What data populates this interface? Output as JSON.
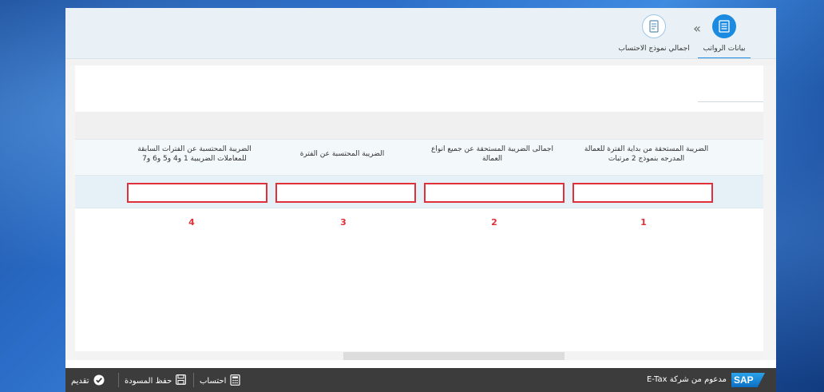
{
  "header": {
    "steps": [
      {
        "label": "بيانات الرواتب",
        "active": true,
        "icon": "list-icon"
      },
      {
        "label": "اجمالي نموذج الاحتساب",
        "active": false,
        "icon": "document-icon"
      }
    ],
    "separator": "«"
  },
  "table": {
    "columns": [
      {
        "number": "1",
        "header": "الضريبة المستحقة من بداية الفترة للعمالة المدرجه بنموذج 2 مرتبات",
        "value": ""
      },
      {
        "number": "2",
        "header": "اجمالى الضريبة المستحقة عن جميع انواع العمالة",
        "value": ""
      },
      {
        "number": "3",
        "header": "الضريبة المحتسبة عن الفترة",
        "value": ""
      },
      {
        "number": "4",
        "header": "الضريبة المحتسبة عن الفترات السابقة للمعاملات الضريبية 1 و4 و5 و6 و7",
        "value": ""
      }
    ]
  },
  "footer": {
    "powered_by": "مدعوم من شركة E-Tax",
    "logo_text": "SAP",
    "calculate_label": "احتساب",
    "save_draft_label": "حفظ المسودة",
    "submit_label": "تقديم"
  },
  "colors": {
    "accent": "#1a8be0",
    "highlight": "#e03039",
    "footer": "#3c3c3c"
  }
}
